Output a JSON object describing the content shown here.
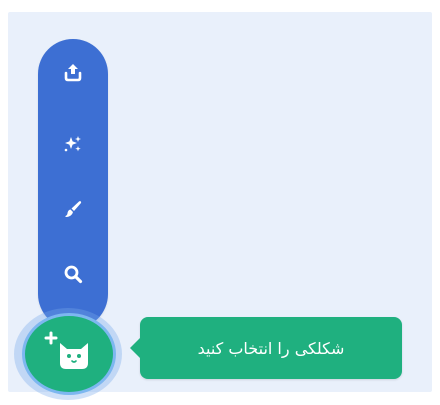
{
  "sprite_menu": {
    "items": [
      {
        "icon": "upload-icon",
        "tooltip": ""
      },
      {
        "icon": "sparkle-surprise-icon",
        "tooltip": ""
      },
      {
        "icon": "paintbrush-icon",
        "tooltip": ""
      },
      {
        "icon": "search-icon",
        "tooltip": ""
      }
    ],
    "main_button_icon": "cat-add-icon",
    "tooltip_label": "شکلکی را انتخاب کنید"
  },
  "colors": {
    "menu_blue": "#3d6fd3",
    "accent_green": "#1fb07f",
    "stage_bg": "#e9f0fb"
  }
}
